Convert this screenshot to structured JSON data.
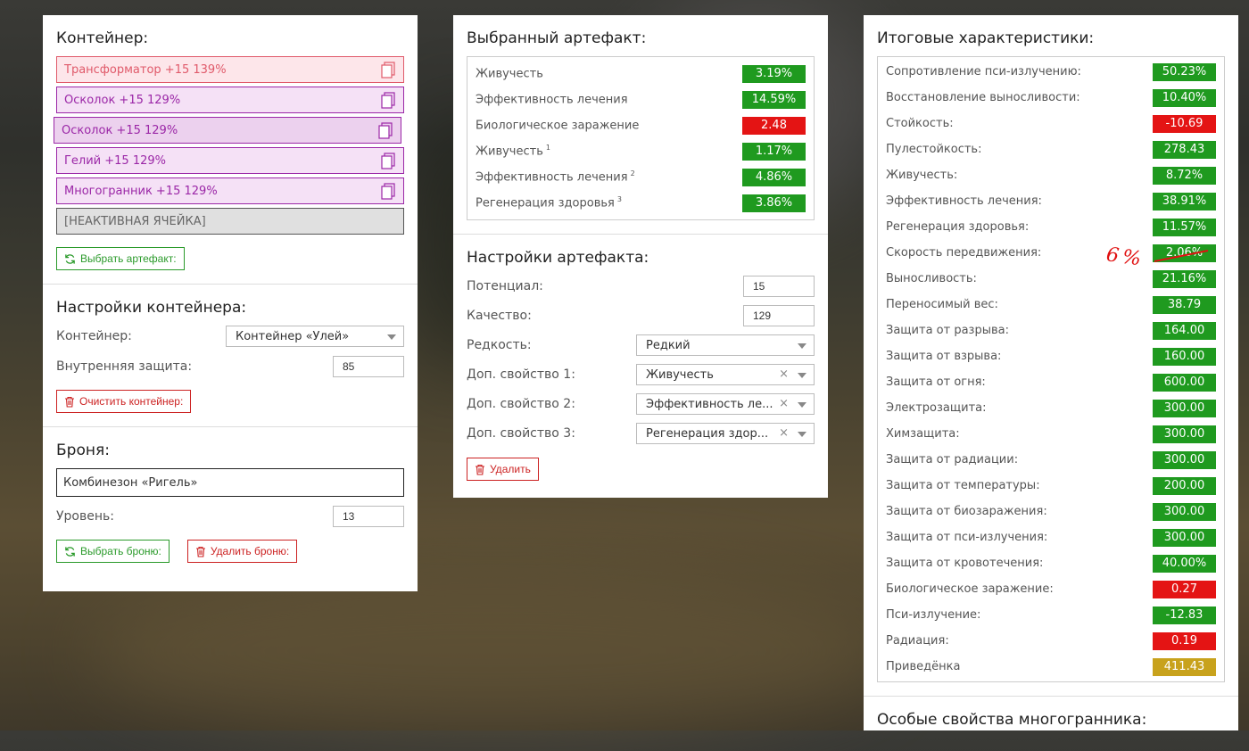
{
  "container_panel": {
    "title": "Контейнер:",
    "slots": [
      {
        "label": "Трансформатор +15 139%"
      },
      {
        "label": "Осколок +15 129%"
      },
      {
        "label": "Осколок +15 129%"
      },
      {
        "label": "Гелий +15 129%"
      },
      {
        "label": "Многогранник +15 129%"
      },
      {
        "label": "[НЕАКТИВНАЯ ЯЧЕЙКА]"
      }
    ],
    "select_artifact_label": "Выбрать артефакт:"
  },
  "container_settings": {
    "title": "Настройки контейнера:",
    "container_label": "Контейнер:",
    "container_value": "Контейнер «Улей»",
    "internal_protection_label": "Внутренняя защита:",
    "internal_protection_value": "85",
    "clear_label": "Очистить контейнер:"
  },
  "armor": {
    "title": "Броня:",
    "armor_value": "Комбинезон «Ригель»",
    "level_label": "Уровень:",
    "level_value": "13",
    "select_label": "Выбрать броню:",
    "delete_label": "Удалить броню:"
  },
  "selected_artifact": {
    "title": "Выбранный артефакт:",
    "stats": [
      {
        "label": "Живучесть",
        "sup": "",
        "value": "3.19%",
        "color": "green"
      },
      {
        "label": "Эффективность лечения",
        "sup": "",
        "value": "14.59%",
        "color": "green"
      },
      {
        "label": "Биологическое заражение",
        "sup": "",
        "value": "2.48",
        "color": "red"
      },
      {
        "label": "Живучесть",
        "sup": "1",
        "value": "1.17%",
        "color": "green"
      },
      {
        "label": "Эффективность лечения",
        "sup": "2",
        "value": "4.86%",
        "color": "green"
      },
      {
        "label": "Регенерация здоровья",
        "sup": "3",
        "value": "3.86%",
        "color": "green"
      }
    ]
  },
  "artifact_settings": {
    "title": "Настройки артефакта:",
    "potential_label": "Потенциал:",
    "potential_value": "15",
    "quality_label": "Качество:",
    "quality_value": "129",
    "rarity_label": "Редкость:",
    "rarity_value": "Редкий",
    "prop1_label": "Доп. свойство 1:",
    "prop1_value": "Живучесть",
    "prop2_label": "Доп. свойство 2:",
    "prop2_value": "Эффективность ле...",
    "prop3_label": "Доп. свойство 3:",
    "prop3_value": "Регенерация здор...",
    "clear_x": "×",
    "delete_label": "Удалить"
  },
  "totals": {
    "title": "Итоговые характеристики:",
    "stats": [
      {
        "label": "Сопротивление пси-излучению:",
        "value": "50.23%",
        "color": "green"
      },
      {
        "label": "Восстановление выносливости:",
        "value": "10.40%",
        "color": "green"
      },
      {
        "label": "Стойкость:",
        "value": "-10.69",
        "color": "red"
      },
      {
        "label": "Пулестойкость:",
        "value": "278.43",
        "color": "green"
      },
      {
        "label": "Живучесть:",
        "value": "8.72%",
        "color": "green"
      },
      {
        "label": "Эффективность лечения:",
        "value": "38.91%",
        "color": "green"
      },
      {
        "label": "Регенерация здоровья:",
        "value": "11.57%",
        "color": "green"
      },
      {
        "label": "Скорость передвижения:",
        "value": "2.06%",
        "color": "green"
      },
      {
        "label": "Выносливость:",
        "value": "21.16%",
        "color": "green"
      },
      {
        "label": "Переносимый вес:",
        "value": "38.79",
        "color": "green"
      },
      {
        "label": "Защита от разрыва:",
        "value": "164.00",
        "color": "green"
      },
      {
        "label": "Защита от взрыва:",
        "value": "160.00",
        "color": "green"
      },
      {
        "label": "Защита от огня:",
        "value": "600.00",
        "color": "green"
      },
      {
        "label": "Электрозащита:",
        "value": "300.00",
        "color": "green"
      },
      {
        "label": "Химзащита:",
        "value": "300.00",
        "color": "green"
      },
      {
        "label": "Защита от радиации:",
        "value": "300.00",
        "color": "green"
      },
      {
        "label": "Защита от температуры:",
        "value": "200.00",
        "color": "green"
      },
      {
        "label": "Защита от биозаражения:",
        "value": "300.00",
        "color": "green"
      },
      {
        "label": "Защита от пси-излучения:",
        "value": "300.00",
        "color": "green"
      },
      {
        "label": "Защита от кровотечения:",
        "value": "40.00%",
        "color": "green"
      },
      {
        "label": "Биологическое заражение:",
        "value": "0.27",
        "color": "red"
      },
      {
        "label": "Пси-излучение:",
        "value": "-12.83",
        "color": "green"
      },
      {
        "label": "Радиация:",
        "value": "0.19",
        "color": "red"
      },
      {
        "label": "Приведёнка",
        "value": "411.43",
        "color": "gold"
      }
    ],
    "annotation": "6%",
    "next_title": "Особые свойства многогранника:"
  },
  "colors": {
    "green": "#1f9a1f",
    "red": "#e41414",
    "gold": "#c8a21c",
    "annotation": "#e01010"
  }
}
